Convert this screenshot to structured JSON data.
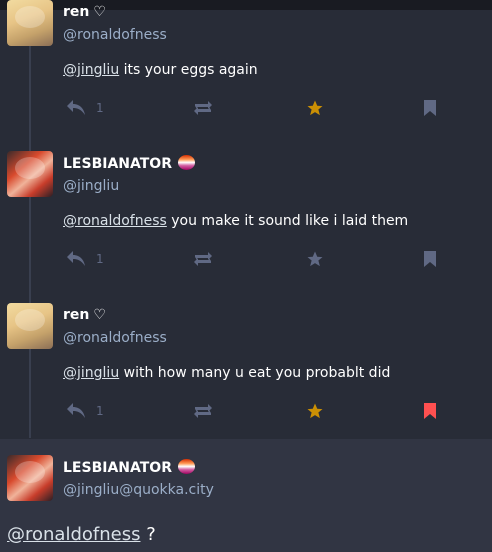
{
  "colors": {
    "background": "#282c37",
    "focused_background": "#313543",
    "muted": "#606984",
    "handle": "#9baec8",
    "favourite_active": "#ca8f04",
    "bookmark_active": "#ff5050"
  },
  "statuses": [
    {
      "display_name": "ren",
      "name_suffix": "♡",
      "handle": "@ronaldofness",
      "mention": "@jingliu",
      "text": " its your eggs again",
      "replies": "1",
      "favourited": true,
      "bookmarked": false
    },
    {
      "display_name": "LESBIANATOR",
      "handle": "@jingliu",
      "mention": "@ronaldofness",
      "text": " you make it sound like i laid them",
      "replies": "1",
      "favourited": false,
      "bookmarked": false
    },
    {
      "display_name": "ren",
      "name_suffix": "♡",
      "handle": "@ronaldofness",
      "mention": "@jingliu",
      "text": " with how many u eat you probablt did",
      "replies": "1",
      "favourited": true,
      "bookmarked": true
    }
  ],
  "focused_status": {
    "display_name": "LESBIANATOR",
    "handle": "@jingliu@quokka.city",
    "mention": "@ronaldofness",
    "text": " ?"
  }
}
